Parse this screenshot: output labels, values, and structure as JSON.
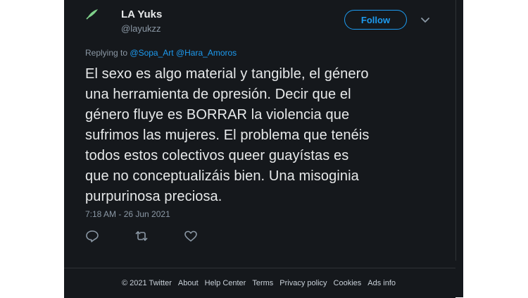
{
  "tweet": {
    "display_name": "LA Yuks",
    "handle": "@layukzz",
    "follow_label": "Follow",
    "replying_prefix": "Replying to",
    "replying_to": [
      "@Sopa_Art",
      "@Hara_Amoros"
    ],
    "text_lines": [
      "El sexo es algo material y tangible, el género",
      "una herramienta de opresión. Decir que el",
      "género fluye es BORRAR la violencia que",
      "sufrimos las mujeres. El problema que tenéis",
      "todos estos colectivos queer guayístas es",
      "que no conceptualizáis bien. Una misoginia",
      "purpurinosa preciosa."
    ],
    "timestamp": "7:18 AM - 26 Jun 2021",
    "icons": {
      "reply": "reply-icon",
      "retweet": "retweet-icon",
      "like": "like-icon",
      "avatar": "avatar-icon",
      "chevron": "chevron-down-icon"
    }
  },
  "footer": {
    "links": [
      "© 2021 Twitter",
      "About",
      "Help Center",
      "Terms",
      "Privacy policy",
      "Cookies",
      "Ads info"
    ]
  },
  "colors": {
    "background": "#15181c",
    "accent": "#1d9bf0",
    "text": "#e7e9ea",
    "muted": "#8b98a5"
  }
}
